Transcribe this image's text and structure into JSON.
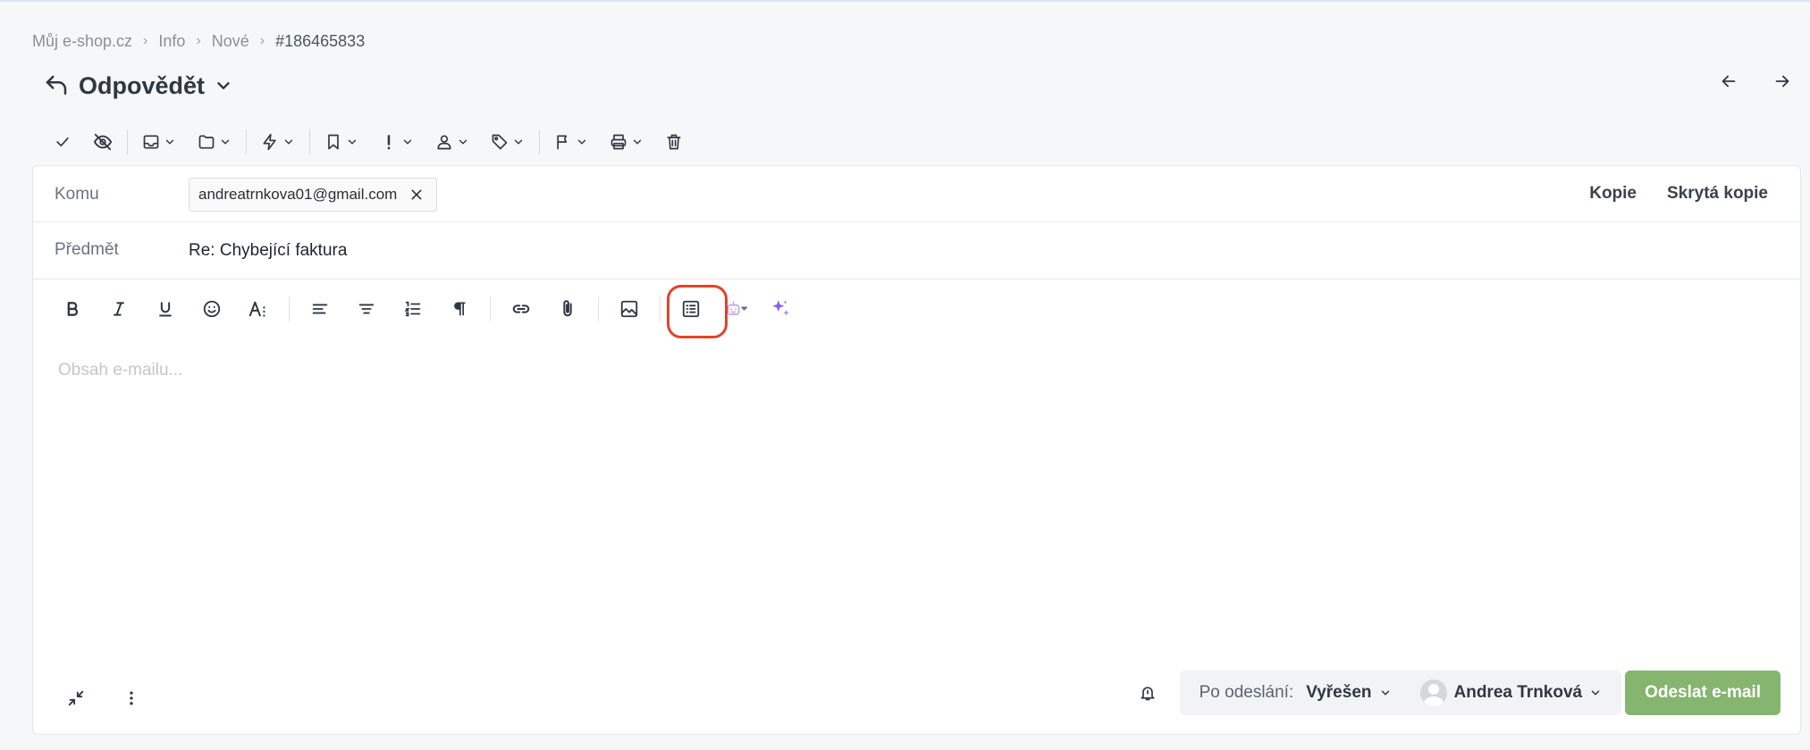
{
  "breadcrumb": [
    "Můj e-shop.cz",
    "Info",
    "Nové",
    "#186465833"
  ],
  "header": {
    "title": "Odpovědět"
  },
  "form": {
    "to_label": "Komu",
    "to_email": "andreatrnkova01@gmail.com",
    "cc_label": "Kopie",
    "bcc_label": "Skrytá kopie",
    "subject_label": "Předmět",
    "subject_value": "Re: Chybející faktura"
  },
  "editor": {
    "placeholder": "Obsah e-mailu..."
  },
  "footer": {
    "after_send_label": "Po odeslání:",
    "status": "Vyřešen",
    "assignee": "Andrea Trnková",
    "send_label": "Odeslat e-mail"
  },
  "colors": {
    "accent_green": "#85b56e",
    "highlight_red": "#e2432a",
    "ai_purple": "#8b5cf6"
  }
}
